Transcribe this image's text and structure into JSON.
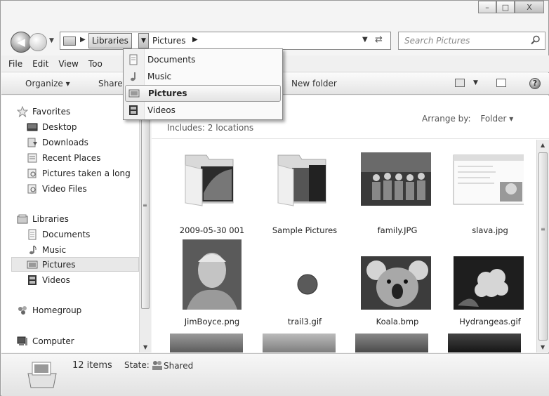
{
  "window": {
    "caption": {
      "minimize": "–",
      "maximize": "□",
      "close": "X"
    }
  },
  "address": {
    "crumbs": [
      "Libraries",
      "Pictures"
    ],
    "search_placeholder": "Search Pictures"
  },
  "menu": [
    "File",
    "Edit",
    "View",
    "Too"
  ],
  "toolbar": {
    "organize": "Organize ▾",
    "share": "Share",
    "new_folder": "New folder"
  },
  "sidebar": {
    "favorites": "Favorites",
    "favorites_items": [
      "Desktop",
      "Downloads",
      "Recent Places",
      "Pictures taken a long",
      "Video Files"
    ],
    "libraries": "Libraries",
    "libraries_items": [
      "Documents",
      "Music",
      "Pictures",
      "Videos"
    ],
    "homegroup": "Homegroup",
    "computer": "Computer"
  },
  "content": {
    "includes": "Includes:  2 locations",
    "arrange_label": "Arrange by:",
    "arrange_value": "Folder ▾",
    "items": [
      {
        "name": "2009-05-30 001",
        "kind": "folder"
      },
      {
        "name": "Sample Pictures",
        "kind": "folder"
      },
      {
        "name": "family.JPG",
        "kind": "photo"
      },
      {
        "name": "slava.jpg",
        "kind": "screenshot"
      },
      {
        "name": "JimBoyce.png",
        "kind": "portrait"
      },
      {
        "name": "trail3.gif",
        "kind": "dot"
      },
      {
        "name": "Koala.bmp",
        "kind": "koala"
      },
      {
        "name": "Hydrangeas.gif",
        "kind": "flower"
      }
    ]
  },
  "status": {
    "count": "12 items",
    "state_label": "State:",
    "state_value": "Shared"
  },
  "dropdown": {
    "items": [
      "Documents",
      "Music",
      "Pictures",
      "Videos"
    ],
    "selected": "Pictures"
  }
}
